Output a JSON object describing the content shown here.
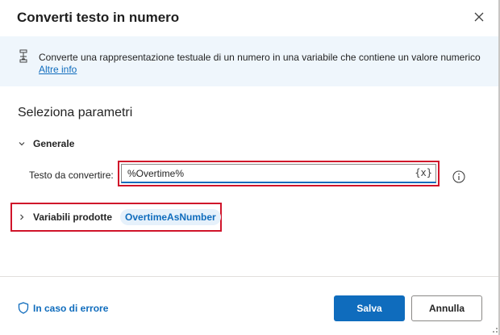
{
  "dialog": {
    "title": "Converti testo in numero",
    "close_icon": "close-icon"
  },
  "banner": {
    "icon": "action-info-icon",
    "text": "Converte una rappresentazione testuale di un numero in una variabile che contiene un valore numerico",
    "link": "Altre info"
  },
  "params": {
    "section_title": "Seleziona parametri",
    "group_label": "Generale",
    "field_label": "Testo da convertire:",
    "field_value": "%Overtime%",
    "var_button": "{x}",
    "info_icon": "info-circle-icon"
  },
  "produced": {
    "label": "Variabili prodotte",
    "variable": "OvertimeAsNumber"
  },
  "footer": {
    "error_link": "In caso di errore",
    "save_label": "Salva",
    "cancel_label": "Annulla"
  },
  "colors": {
    "accent": "#0f6cbd",
    "highlight": "#d0142a",
    "banner_bg": "#eff6fc"
  }
}
